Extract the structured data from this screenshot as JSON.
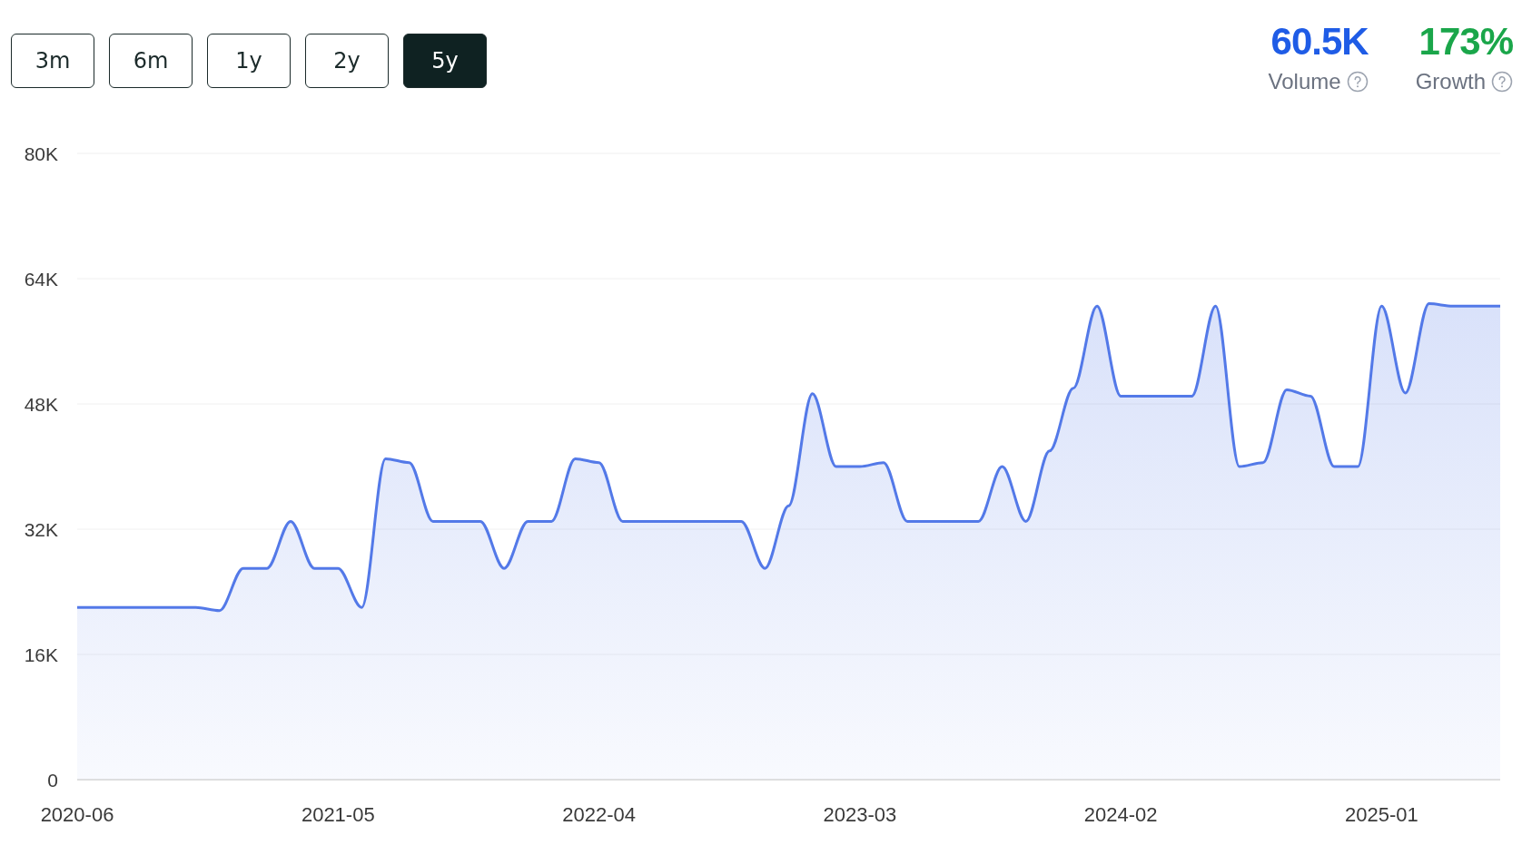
{
  "ranges": [
    {
      "label": "3m",
      "selected": false
    },
    {
      "label": "6m",
      "selected": false
    },
    {
      "label": "1y",
      "selected": false
    },
    {
      "label": "2y",
      "selected": false
    },
    {
      "label": "5y",
      "selected": true
    }
  ],
  "stats": [
    {
      "value": "60.5K",
      "label": "Volume",
      "color": "#1f5ce6"
    },
    {
      "value": "173%",
      "label": "Growth",
      "color": "#1aa64a"
    }
  ],
  "chart_data": {
    "type": "area",
    "grid": true,
    "categories": [
      "2020-06",
      null,
      null,
      null,
      null,
      null,
      null,
      null,
      null,
      null,
      null,
      "2021-05",
      null,
      null,
      null,
      null,
      null,
      null,
      null,
      null,
      null,
      null,
      "2022-04",
      null,
      null,
      null,
      null,
      null,
      null,
      null,
      null,
      null,
      null,
      "2023-03",
      null,
      null,
      null,
      null,
      null,
      null,
      null,
      null,
      null,
      null,
      "2024-02",
      null,
      null,
      null,
      null,
      null,
      null,
      null,
      null,
      null,
      null,
      "2025-01",
      null,
      null,
      null,
      null,
      null
    ],
    "series": [
      {
        "color": "#5379e8",
        "values": [
          22000,
          22000,
          22000,
          22000,
          22000,
          22000,
          21600,
          27000,
          27000,
          33000,
          27000,
          27000,
          22000,
          41000,
          40500,
          33000,
          33000,
          33000,
          27000,
          33000,
          33000,
          41000,
          40500,
          33000,
          33000,
          33000,
          33000,
          33000,
          33000,
          27000,
          35000,
          49300,
          40000,
          40000,
          40500,
          33000,
          33000,
          33000,
          33000,
          40000,
          33000,
          42000,
          50000,
          60500,
          49000,
          49000,
          49000,
          49000,
          60500,
          40000,
          40500,
          49800,
          49000,
          40000,
          40000,
          60500,
          49400,
          60800,
          60500,
          60500,
          60500
        ]
      }
    ],
    "ylim": [
      0,
      80000
    ],
    "yticks": [
      {
        "value": 0,
        "label": "0"
      },
      {
        "value": 16000,
        "label": "16K"
      },
      {
        "value": 32000,
        "label": "32K"
      },
      {
        "value": 48000,
        "label": "48K"
      },
      {
        "value": 64000,
        "label": "64K"
      },
      {
        "value": 80000,
        "label": "80K"
      }
    ]
  }
}
